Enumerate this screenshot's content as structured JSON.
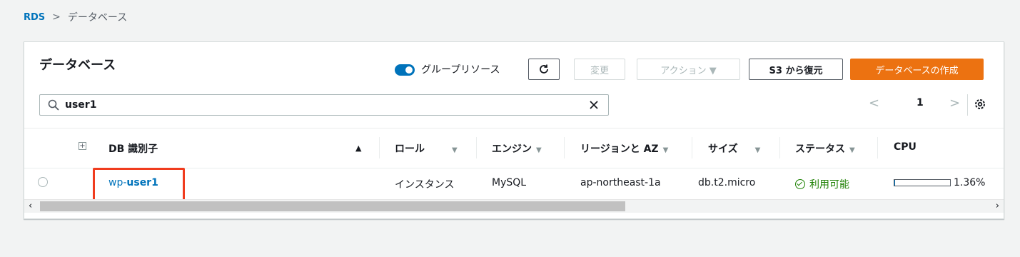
{
  "breadcrumb": {
    "root": "RDS",
    "separator": ">",
    "current": "データベース"
  },
  "panel": {
    "title": "データベース",
    "group_toggle_label": "グループリソース",
    "buttons": {
      "refresh_icon": "refresh-icon",
      "change": "変更",
      "actions": "アクション ▼",
      "restore_s3": "S3 から復元",
      "create": "データベースの作成"
    },
    "search": {
      "value": "user1",
      "icon": "search-icon",
      "clear_icon": "close-icon"
    },
    "pagination": {
      "prev": "<",
      "page": "1",
      "next": ">"
    }
  },
  "table": {
    "headers": {
      "db_id": "DB 識別子",
      "sort": "▲",
      "role": "ロール",
      "engine": "エンジン",
      "region": "リージョンと AZ",
      "size": "サイズ",
      "status": "ステータス",
      "cpu": "CPU",
      "filter_arrow": "▼"
    },
    "row": {
      "db_prefix": "wp-",
      "db_match": "user1",
      "role": "インスタンス",
      "engine": "MySQL",
      "region": "ap-northeast-1a",
      "size": "db.t2.micro",
      "status": "利用可能",
      "cpu_text": "1.36%",
      "cpu_fraction": 0.0136
    }
  },
  "colors": {
    "link": "#0073bb",
    "primary": "#ec7211",
    "success": "#1d8102",
    "highlight": "#f03c1e"
  }
}
